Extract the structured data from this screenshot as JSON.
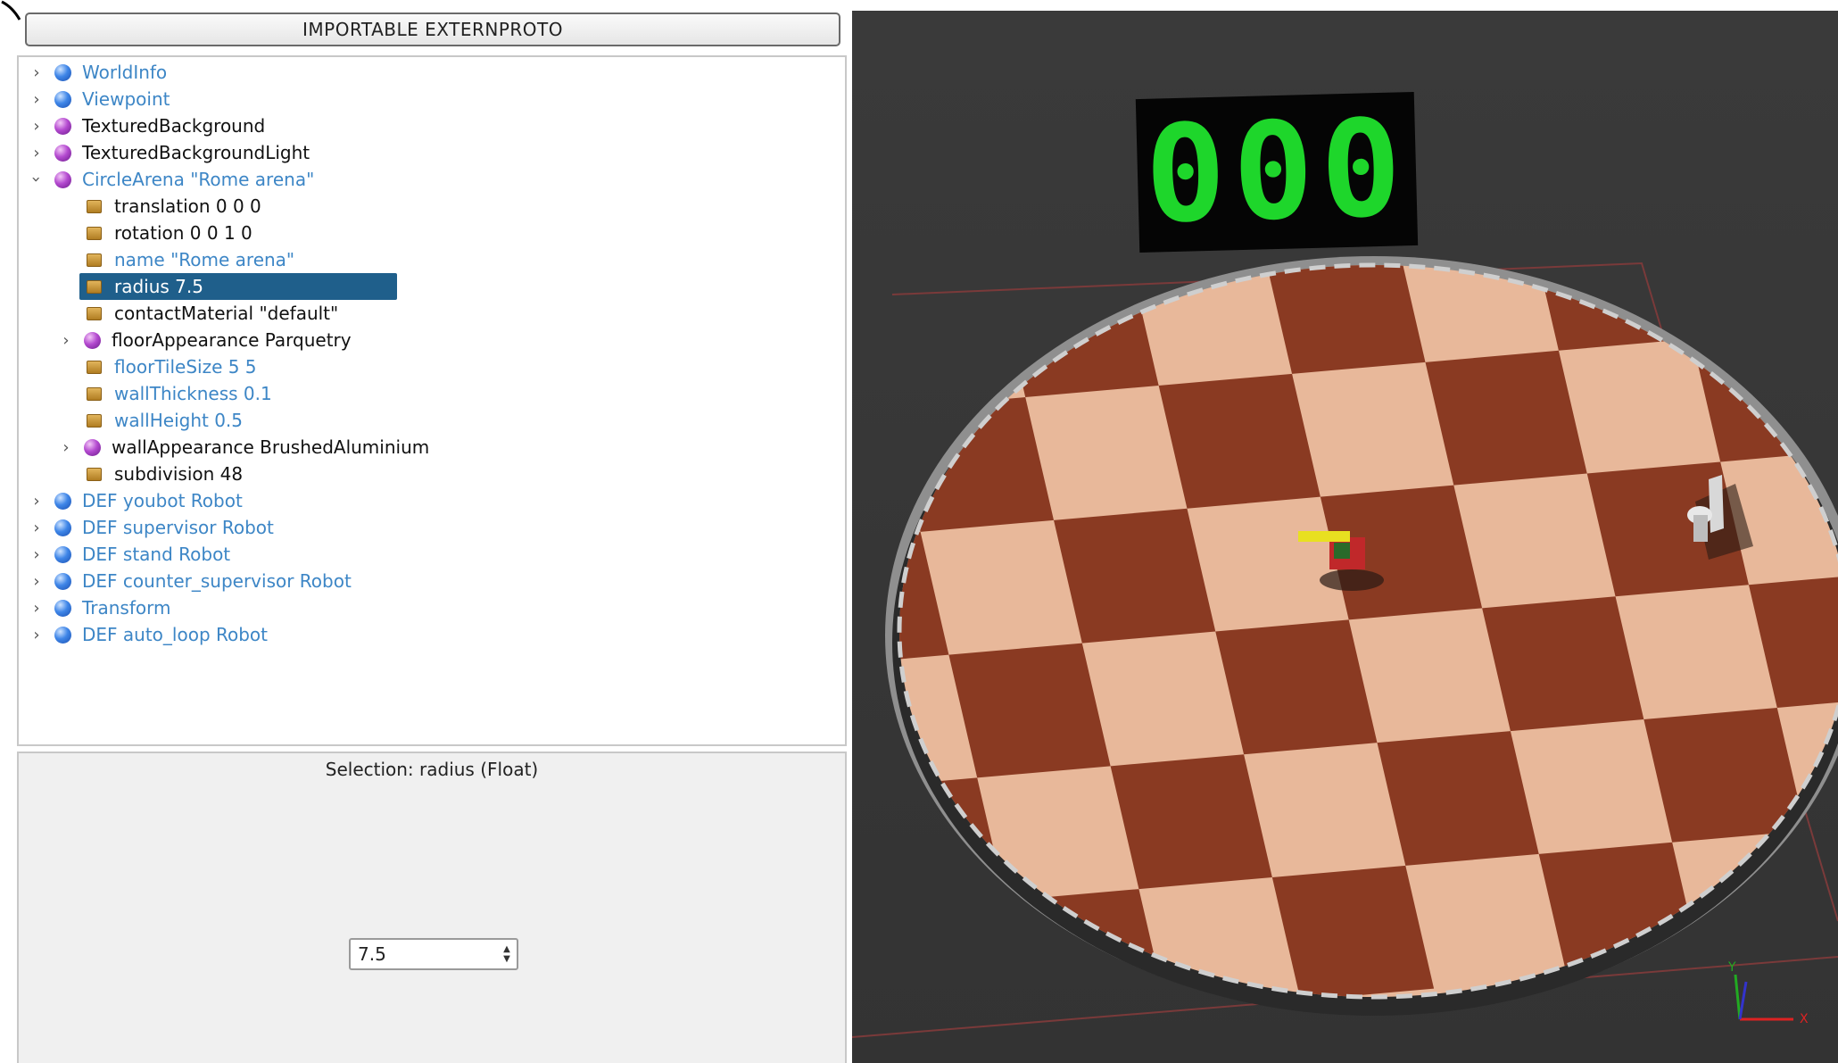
{
  "toolbar": {
    "importable_button": "IMPORTABLE EXTERNPROTO"
  },
  "tree": {
    "items": [
      {
        "label": "WorldInfo",
        "icon": "blue-node-icon",
        "expanded": false
      },
      {
        "label": "Viewpoint",
        "icon": "blue-node-icon",
        "expanded": false
      },
      {
        "label": "TexturedBackground",
        "icon": "purple-proto-icon",
        "expanded": false
      },
      {
        "label": "TexturedBackgroundLight",
        "icon": "purple-proto-icon",
        "expanded": false
      },
      {
        "label": "CircleArena \"Rome arena\"",
        "icon": "purple-proto-icon",
        "expanded": true
      },
      {
        "label": "translation 0 0 0",
        "icon": "field-icon"
      },
      {
        "label": "rotation 0 0 1 0",
        "icon": "field-icon"
      },
      {
        "label": "name \"Rome arena\"",
        "icon": "field-icon"
      },
      {
        "label": "radius 7.5",
        "icon": "field-icon",
        "selected": true
      },
      {
        "label": "contactMaterial \"default\"",
        "icon": "field-icon"
      },
      {
        "label": "floorAppearance Parquetry",
        "icon": "purple-proto-icon",
        "expanded": false
      },
      {
        "label": "floorTileSize 5 5",
        "icon": "field-icon"
      },
      {
        "label": "wallThickness 0.1",
        "icon": "field-icon"
      },
      {
        "label": "wallHeight 0.5",
        "icon": "field-icon"
      },
      {
        "label": "wallAppearance BrushedAluminium",
        "icon": "purple-proto-icon",
        "expanded": false
      },
      {
        "label": "subdivision 48",
        "icon": "field-icon"
      },
      {
        "label": "DEF youbot Robot",
        "icon": "blue-node-icon",
        "expanded": false
      },
      {
        "label": "DEF supervisor Robot",
        "icon": "blue-node-icon",
        "expanded": false
      },
      {
        "label": "DEF stand Robot",
        "icon": "blue-node-icon",
        "expanded": false
      },
      {
        "label": "DEF counter_supervisor Robot",
        "icon": "blue-node-icon",
        "expanded": false
      },
      {
        "label": "Transform",
        "icon": "blue-node-icon",
        "expanded": false
      },
      {
        "label": "DEF auto_loop Robot",
        "icon": "blue-node-icon",
        "expanded": false
      }
    ]
  },
  "field_editor": {
    "selection_label": "Selection: radius (Float)",
    "value": "7.5"
  },
  "view3d": {
    "scoreboard": "000",
    "axis_x": "X",
    "axis_y": "Y"
  },
  "colors": {
    "link_blue": "#3d86c6",
    "selection_bg": "#1f5f8b",
    "scoreboard_green": "#1ed62b"
  }
}
